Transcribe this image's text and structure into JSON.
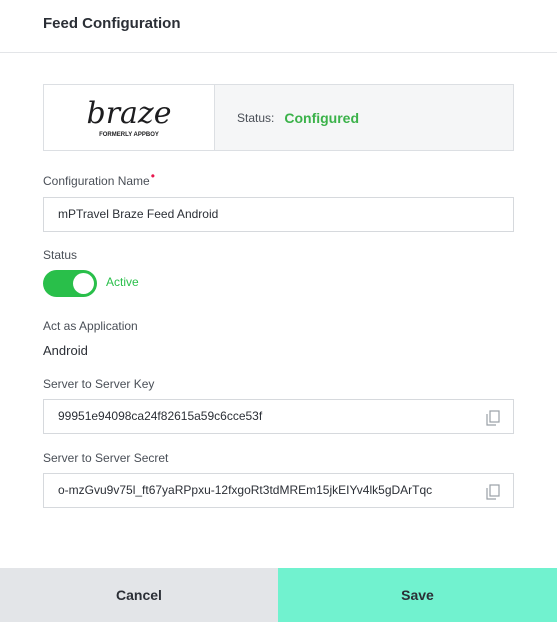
{
  "header": {
    "title": "Feed Configuration"
  },
  "card": {
    "logo_text": "braze",
    "logo_subtext": "FORMERLY APPBOY",
    "status_label": "Status:",
    "status_value": "Configured",
    "status_color": "#3bb24a"
  },
  "form": {
    "config_name_label": "Configuration Name",
    "config_name_required": "•",
    "config_name_value": "mPTravel Braze Feed Android",
    "status_label": "Status",
    "status_toggle_on": true,
    "status_toggle_text": "Active",
    "act_as_label": "Act as Application",
    "act_as_value": "Android",
    "server_key_label": "Server to Server Key",
    "server_key_value": "99951e94098ca24f82615a59c6cce53f",
    "server_secret_label": "Server to Server Secret",
    "server_secret_value": "o-mzGvu9v75l_ft67yaRPpxu-12fxgoRt3tdMREm15jkEIYv4lk5gDArTqc"
  },
  "footer": {
    "cancel_label": "Cancel",
    "save_label": "Save"
  },
  "colors": {
    "accent": "#29bf4a",
    "save_button": "#71f2cf",
    "cancel_button": "#e3e5e8"
  }
}
